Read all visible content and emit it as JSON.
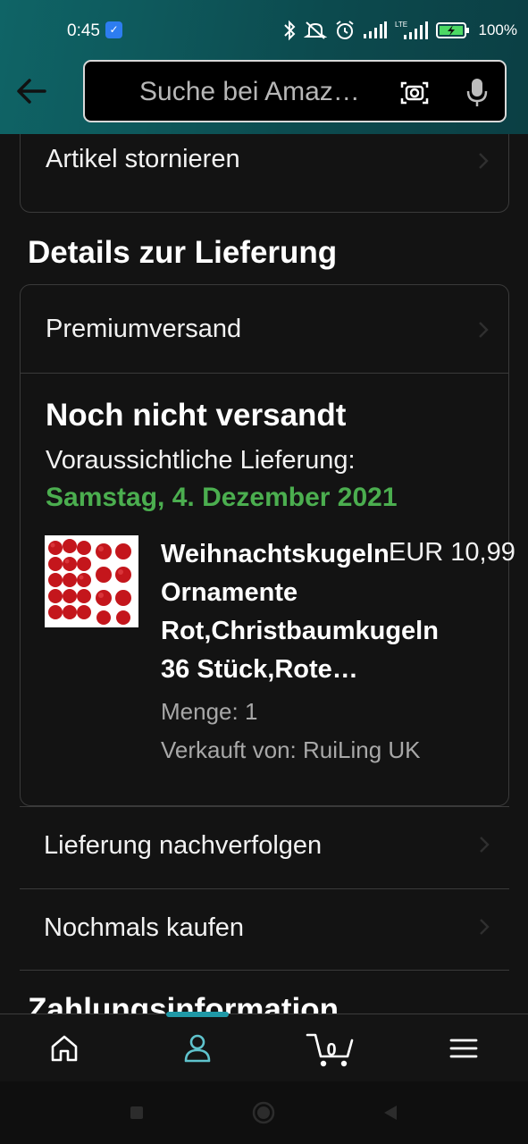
{
  "status_bar": {
    "time": "0:45",
    "battery": "100%",
    "network_label": "LTE"
  },
  "search": {
    "placeholder": "Suche bei Amaz…"
  },
  "top_card": {
    "label": "Artikel stornieren"
  },
  "delivery_section": {
    "title": "Details zur Lieferung",
    "shipping_method": "Premiumversand",
    "status": "Noch nicht versandt",
    "expected_label": "Voraussichtliche Lieferung:",
    "expected_date": "Samstag, 4. Dezember 2021",
    "product": {
      "title": "Weihnachtskugeln Ornamente Rot,Christbaumkugeln 36 Stück,Rote…",
      "price": "EUR 10,99",
      "quantity": "Menge: 1",
      "seller": "Verkauft von: RuiLing UK"
    }
  },
  "actions": [
    {
      "label": "Lieferung nachverfolgen"
    },
    {
      "label": "Nochmals kaufen"
    }
  ],
  "payment_section": {
    "title": "Zahlungsinformation"
  },
  "bottom_nav": {
    "cart_count": "0",
    "active": "account"
  },
  "colors": {
    "header_teal": "#0f6466",
    "delivery_green": "#4bae4f",
    "nav_indicator": "#1f98a6",
    "background": "#131313"
  },
  "icons": [
    "back-arrow-icon",
    "camera-icon",
    "mic-icon",
    "home-icon",
    "account-icon",
    "cart-icon",
    "menu-icon",
    "chevron-right-icon"
  ]
}
